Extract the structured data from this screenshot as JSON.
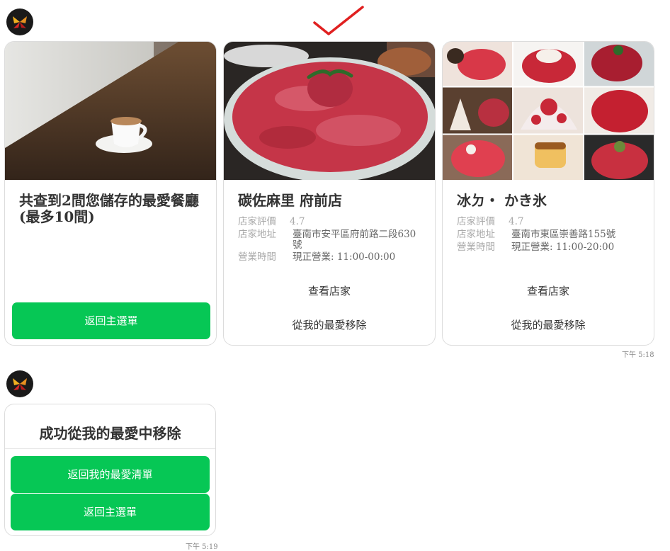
{
  "bot": {
    "avatar_icon": "butterfly-logo-icon"
  },
  "carousel": {
    "summary_card": {
      "title": "共查到2間您儲存的最愛餐廳(最多10間)",
      "menu_button": "返回主選單"
    },
    "restaurants": [
      {
        "name": "碳佐麻里 府前店",
        "rating_label": "店家評價",
        "rating": "4.7",
        "address_label": "店家地址",
        "address": "臺南市安平區府前路二段630號",
        "hours_label": "營業時間",
        "hours": "現正營業: 11:00-00:00",
        "view_button": "查看店家",
        "remove_button": "從我的最愛移除"
      },
      {
        "name": "冰ㄉ・ かき氷",
        "rating_label": "店家評價",
        "rating": "4.7",
        "address_label": "店家地址",
        "address": "臺南市東區崇善路155號",
        "hours_label": "營業時間",
        "hours": "現正營業: 11:00-20:00",
        "view_button": "查看店家",
        "remove_button": "從我的最愛移除"
      }
    ],
    "timestamp": "下午 5:18"
  },
  "confirmation": {
    "title": "成功從我的最愛中移除",
    "favorites_button": "返回我的最愛清單",
    "menu_button": "返回主選單",
    "timestamp": "下午 5:19"
  },
  "colors": {
    "accent_green": "#06c755",
    "annotation_red": "#e02020"
  }
}
